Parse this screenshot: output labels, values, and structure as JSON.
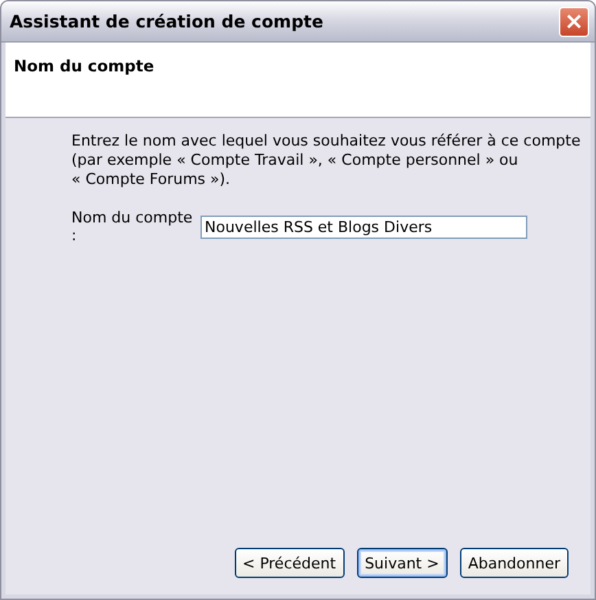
{
  "window": {
    "title": "Assistant de création de compte",
    "close": "×"
  },
  "header": {
    "title": "Nom du compte"
  },
  "description": [
    "Entrez le nom avec lequel vous souhaitez vous référer à ce compte",
    "(par exemple « Compte Travail », « Compte personnel » ou",
    "« Compte Forums »)."
  ],
  "field": {
    "label": "Nom du compte :",
    "value": "Nouvelles RSS et Blogs Divers"
  },
  "buttons": [
    {
      "label": "< Précédent",
      "default": false
    },
    {
      "label": "Suivant >",
      "default": true
    },
    {
      "label": "Abandonner",
      "default": false
    }
  ]
}
